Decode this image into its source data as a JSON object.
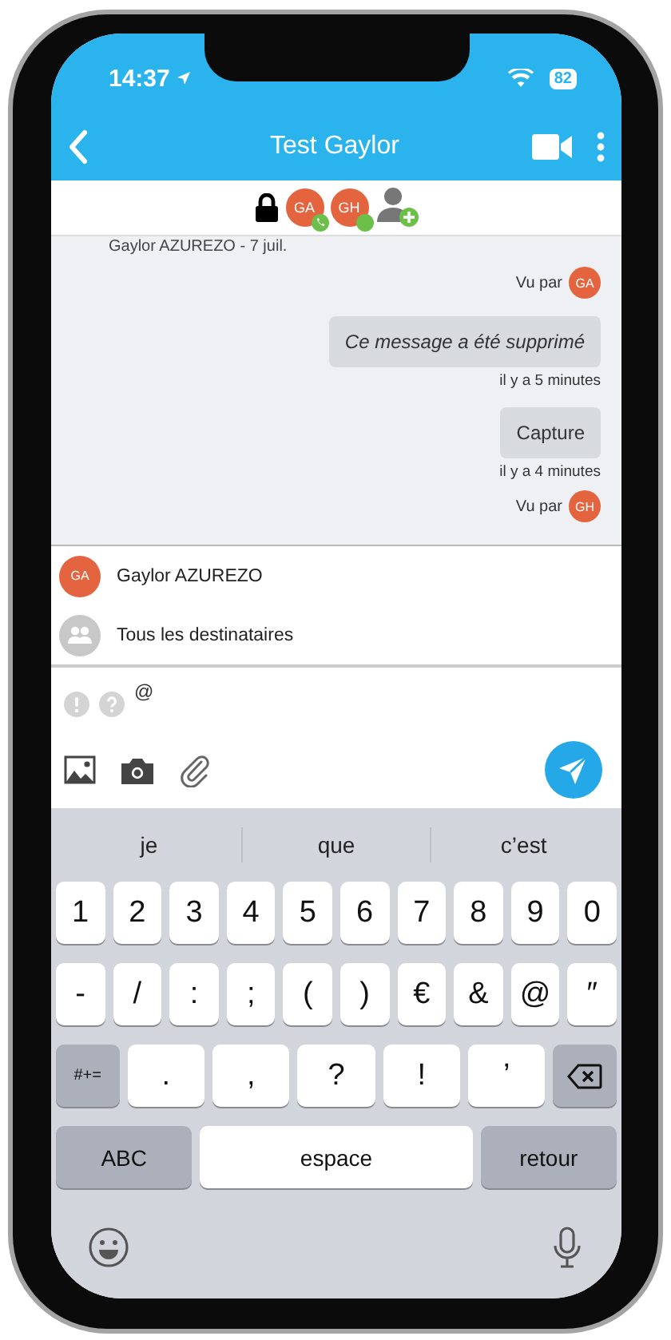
{
  "status_bar": {
    "time": "14:37",
    "battery": "82"
  },
  "header": {
    "title": "Test Gaylor"
  },
  "participants": [
    {
      "initials": "GA",
      "kind": "calling"
    },
    {
      "initials": "GH",
      "kind": "online"
    }
  ],
  "messages": [
    {
      "kind": "meta",
      "text": "Gaylor AZUREZO - 7 juil."
    },
    {
      "kind": "seen",
      "text": "Vu par",
      "initials": "GA"
    },
    {
      "kind": "bubble",
      "text": "Ce message a été supprimé",
      "deleted": true
    },
    {
      "kind": "time",
      "text": "il y a 5 minutes"
    },
    {
      "kind": "bubble",
      "text": "Capture",
      "deleted": false
    },
    {
      "kind": "time",
      "text": "il y a 4 minutes"
    },
    {
      "kind": "seen",
      "text": "Vu par",
      "initials": "GH"
    }
  ],
  "mentions": [
    {
      "kind": "user",
      "initials": "GA",
      "name": "Gaylor AZUREZO"
    },
    {
      "kind": "group",
      "name": "Tous les destinataires"
    }
  ],
  "composer": {
    "value": "@"
  },
  "keyboard": {
    "suggestions": [
      "je",
      "que",
      "c’est"
    ],
    "number_row": [
      {
        "kind": "char",
        "label": "1"
      },
      {
        "kind": "char",
        "label": "2"
      },
      {
        "kind": "char",
        "label": "3"
      },
      {
        "kind": "char",
        "label": "4"
      },
      {
        "kind": "char",
        "label": "5"
      },
      {
        "kind": "char",
        "label": "6"
      },
      {
        "kind": "char",
        "label": "7"
      },
      {
        "kind": "char",
        "label": "8"
      },
      {
        "kind": "char",
        "label": "9"
      },
      {
        "kind": "char",
        "label": "0"
      }
    ],
    "symbol_row": [
      {
        "kind": "char",
        "label": "-"
      },
      {
        "kind": "char",
        "label": "/"
      },
      {
        "kind": "char",
        "label": ":"
      },
      {
        "kind": "char",
        "label": ";"
      },
      {
        "kind": "char",
        "label": "("
      },
      {
        "kind": "char",
        "label": ")"
      },
      {
        "kind": "char",
        "label": "€"
      },
      {
        "kind": "char",
        "label": "&"
      },
      {
        "kind": "char",
        "label": "@"
      },
      {
        "kind": "char",
        "label": "″"
      }
    ],
    "punctuation_row": [
      {
        "kind": "mod",
        "label": "#+="
      },
      {
        "kind": "wide",
        "label": "."
      },
      {
        "kind": "wide",
        "label": ","
      },
      {
        "kind": "wide",
        "label": "?"
      },
      {
        "kind": "wide",
        "label": "!"
      },
      {
        "kind": "wide",
        "label": "’"
      },
      {
        "kind": "delete"
      }
    ],
    "bottom_row": [
      {
        "kind": "abc",
        "label": "ABC"
      },
      {
        "kind": "space",
        "label": "espace"
      },
      {
        "kind": "return",
        "label": "retour"
      }
    ]
  }
}
